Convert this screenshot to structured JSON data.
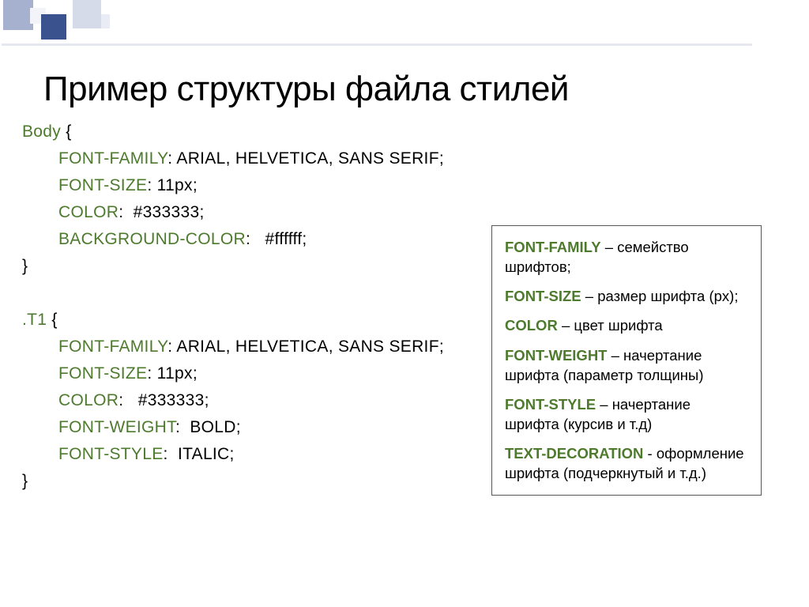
{
  "title": "Пример структуры файла стилей",
  "code": {
    "block1": {
      "selector": "Body",
      "props": [
        {
          "name": "font-family",
          "value": "Arial, Helvetica, sans serif;"
        },
        {
          "name": "font-size",
          "value": "11px;"
        },
        {
          "name": "color",
          "value": "#333333;"
        },
        {
          "name": "background-color",
          "value": "#ffffff;"
        }
      ]
    },
    "block2": {
      "selector": ".T1",
      "props": [
        {
          "name": "font-family",
          "value": "Arial, Helvetica, sans serif;"
        },
        {
          "name": "font-size",
          "value": "11px;"
        },
        {
          "name": "color",
          "value": "#333333;"
        },
        {
          "name": "font-weight",
          "value": "bold;"
        },
        {
          "name": "font-style",
          "value": "italic;"
        }
      ]
    }
  },
  "legend": {
    "items": [
      {
        "term": "Font-family",
        "desc": " – семейство шрифтов;"
      },
      {
        "term": "Font-size",
        "desc": " – размер шрифта (px);"
      },
      {
        "term": "Color",
        "desc": " – цвет шрифта"
      },
      {
        "term": "Font-weight",
        "desc": " – начертание шрифта (параметр толщины)"
      },
      {
        "term": "Font-style",
        "desc": " – начертание шрифта (курсив и т.д)"
      },
      {
        "term": "Text-decoration",
        "desc": "  - оформление шрифта (подчеркнутый и т.д.)"
      }
    ]
  }
}
